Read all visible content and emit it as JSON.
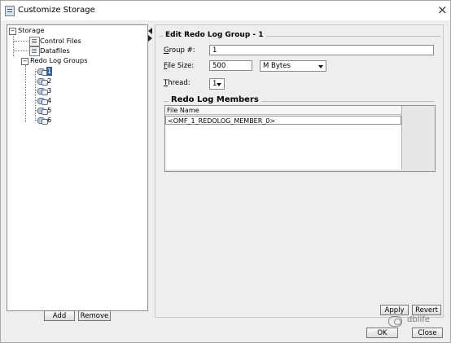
{
  "window": {
    "title": "Customize Storage",
    "close_label": "×"
  },
  "tree": {
    "root": {
      "label": "Storage",
      "toggle": "−"
    },
    "control_files": "Control Files",
    "datafiles": "Datafiles",
    "redo_group": {
      "label": "Redo Log Groups",
      "toggle": "−"
    },
    "groups": [
      "1",
      "2",
      "3",
      "4",
      "5",
      "6"
    ]
  },
  "left_buttons": {
    "add": "Add",
    "remove": "Remove"
  },
  "edit": {
    "title": "Edit Redo Log Group - 1",
    "group_label": "Group #:",
    "group_value": "1",
    "file_size_label": "File Size:",
    "file_size_value": "500",
    "unit_value": "M Bytes",
    "thread_label": "Thread:",
    "thread_value": "1"
  },
  "members": {
    "title": "Redo Log Members",
    "column": "File Name",
    "rows": [
      "<OMF_1_REDOLOG_MEMBER_0>"
    ]
  },
  "buttons": {
    "apply": "Apply",
    "revert": "Revert",
    "ok": "OK",
    "close": "Close"
  },
  "watermark": "dblife"
}
